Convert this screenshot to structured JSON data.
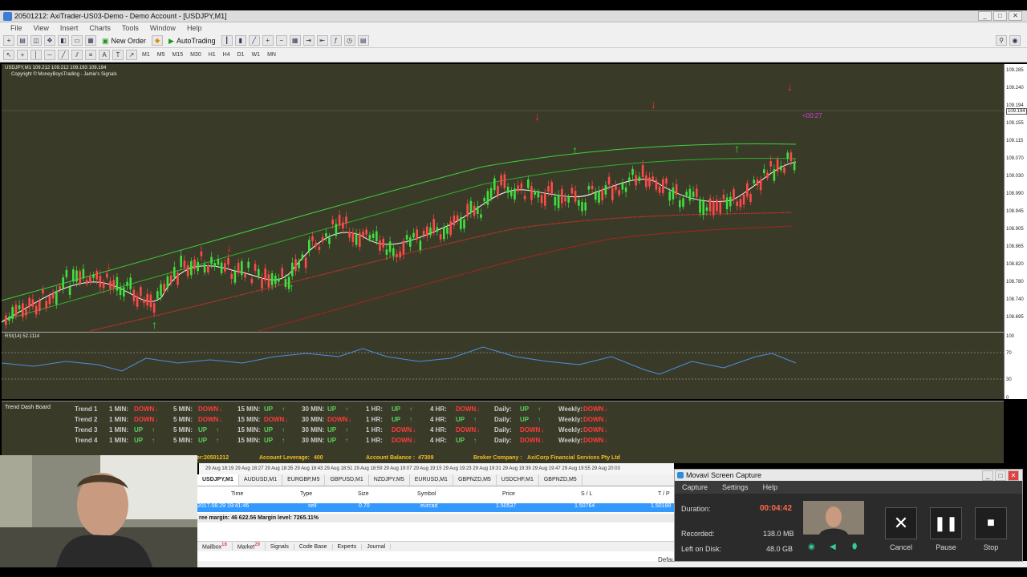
{
  "window": {
    "title": "20501212: AxiTrader-US03-Demo - Demo Account - [USDJPY,M1]"
  },
  "menu": [
    "File",
    "View",
    "Insert",
    "Charts",
    "Tools",
    "Window",
    "Help"
  ],
  "toolbar": {
    "new_order": "New Order",
    "autotrading": "AutoTrading"
  },
  "timeframes": [
    "M1",
    "M5",
    "M15",
    "M30",
    "H1",
    "H4",
    "D1",
    "W1",
    "MN"
  ],
  "chart": {
    "header": "USDJPY,M1  109.212 109.212 109.193 109.194",
    "subheader": "Copyright © MoneyBoysTrading - Jamie's Signals",
    "countdown": "<00:27",
    "price_labels": [
      "109.285",
      "109.240",
      "109.194",
      "109.155",
      "109.115",
      "109.070",
      "109.030",
      "108.990",
      "108.945",
      "108.905",
      "108.865",
      "108.820",
      "108.780",
      "108.740",
      "108.695"
    ],
    "current_price": "109.194",
    "rsi_label": "RSI(14) 52.1114",
    "rsi_levels": [
      "100",
      "70",
      "30",
      "0"
    ]
  },
  "colors": {
    "chart_bg": "#3a3a28",
    "up": "#5bd35b",
    "down": "#ff3a3a",
    "accent": "#f0c020",
    "selected_row": "#3399ff"
  },
  "dashboard": {
    "title": "Trend Dash Board",
    "rows": [
      {
        "name": "Trend 1",
        "m1": "DOWN",
        "m5": "DOWN",
        "m15": "UP",
        "m30": "UP",
        "h1": "UP",
        "h4": "DOWN",
        "daily": "UP",
        "weekly": "DOWN"
      },
      {
        "name": "Trend 2",
        "m1": "DOWN",
        "m5": "DOWN",
        "m15": "DOWN",
        "m30": "DOWN",
        "h1": "UP",
        "h4": "UP",
        "daily": "UP",
        "weekly": "DOWN"
      },
      {
        "name": "Trend 3",
        "m1": "UP",
        "m5": "UP",
        "m15": "UP",
        "m30": "UP",
        "h1": "DOWN",
        "h4": "DOWN",
        "daily": "DOWN",
        "weekly": "DOWN"
      },
      {
        "name": "Trend 4",
        "m1": "UP",
        "m5": "UP",
        "m15": "UP",
        "m30": "UP",
        "h1": "DOWN",
        "h4": "UP",
        "daily": "DOWN",
        "weekly": "DOWN"
      }
    ],
    "tf_labels": {
      "m1": "1 MIN:",
      "m5": "5 MIN:",
      "m15": "15 MIN:",
      "m30": "30 MIN:",
      "h1": "1 HR:",
      "h4": "4 HR:",
      "daily": "Daily:",
      "weekly": "Weekly:"
    }
  },
  "info": {
    "account_number": "er:20501212",
    "leverage_label": "Account Leverage:",
    "leverage": "400",
    "balance_label": "Account Balance :",
    "balance": "47309",
    "broker_label": "Broker Company :",
    "broker": "AxiCorp Financial Services Pty Ltd"
  },
  "timeaxis": "29 Aug 18:19   29 Aug 18:27   29 Aug 18:35   29 Aug 18:43   29 Aug 18:51   29 Aug 18:59   29 Aug 19:07   29 Aug 19:15   29 Aug 19:23   29 Aug 19:31   29 Aug 19:39   29 Aug 19:47   29 Aug 19:55   29 Aug 20:03",
  "chart_tabs": [
    "USDJPY,M1",
    "AUDUSD,M1",
    "EURGBP,M5",
    "GBPUSD,M1",
    "NZDJPY,M5",
    "EURUSD,M1",
    "GBPNZD,M5",
    "USDCHF,M1",
    "GBPNZD,M5"
  ],
  "terminal": {
    "headers": {
      "time": "Time",
      "type": "Type",
      "size": "Size",
      "symbol": "Symbol",
      "price": "Price",
      "sl": "S / L",
      "tp": "T / P"
    },
    "row": {
      "time": "2017.08.29 19:41:46",
      "type": "sell",
      "size": "0.70",
      "symbol": "eurcad",
      "price": "1.50537",
      "sl": "1.50764",
      "tp": "1.50188"
    },
    "margin": "ree margin: 46 622.56   Margin level: 7265.11%",
    "tabs": [
      {
        "label": "Mailbox",
        "badge": "18"
      },
      {
        "label": "Market",
        "badge": "29"
      },
      {
        "label": "Signals",
        "badge": ""
      },
      {
        "label": "Code Base",
        "badge": ""
      },
      {
        "label": "Experts",
        "badge": ""
      },
      {
        "label": "Journal",
        "badge": ""
      }
    ]
  },
  "status": {
    "profile": "Default"
  },
  "movavi": {
    "title": "Movavi Screen Capture",
    "menu": [
      "Capture",
      "Settings",
      "Help"
    ],
    "duration_label": "Duration:",
    "duration": "00:04:42",
    "recorded_label": "Recorded:",
    "recorded": "138.0 MB",
    "disk_label": "Left on Disk:",
    "disk": "48.0 GB",
    "cancel": "Cancel",
    "pause": "Pause",
    "stop": "Stop"
  }
}
